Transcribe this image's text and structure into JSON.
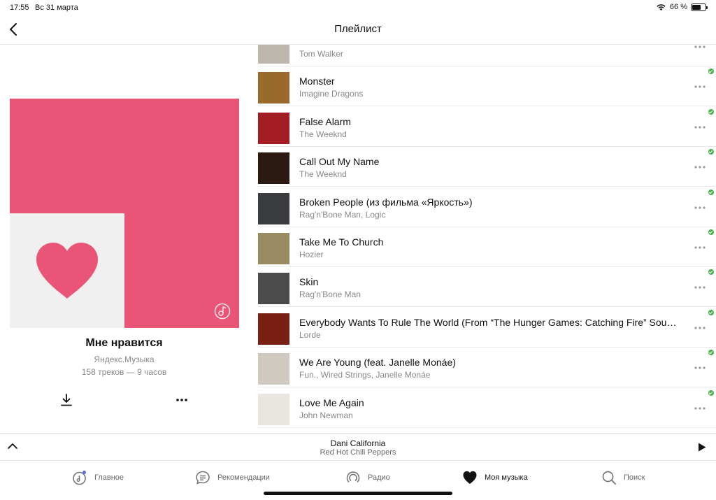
{
  "status_bar": {
    "time": "17:55",
    "date": "Вс 31 марта",
    "battery": "66 %",
    "battery_level": 0.66
  },
  "nav": {
    "title": "Плейлист"
  },
  "playlist": {
    "title": "Мне нравится",
    "owner": "Яндекс.Музыка",
    "meta": "158 треков — 9 часов",
    "cover_color": "#ea5577"
  },
  "tracks": [
    {
      "title": "",
      "artist": "Tom Walker",
      "art": "#bdb7ad",
      "downloaded": false
    },
    {
      "title": "Monster",
      "artist": "Imagine Dragons",
      "art": "#9a6a2c",
      "downloaded": true
    },
    {
      "title": "False Alarm",
      "artist": "The Weeknd",
      "art": "#a51d24",
      "downloaded": true
    },
    {
      "title": "Call Out My Name",
      "artist": "The Weeknd",
      "art": "#2c1a12",
      "downloaded": true
    },
    {
      "title": "Broken People (из фильма «Яркость»)",
      "artist": "Rag'n'Bone Man, Logic",
      "art": "#3a3b3e",
      "downloaded": true
    },
    {
      "title": "Take Me To Church",
      "artist": "Hozier",
      "art": "#9a8a62",
      "downloaded": true
    },
    {
      "title": "Skin",
      "artist": "Rag'n'Bone Man",
      "art": "#4b4b4b",
      "downloaded": true
    },
    {
      "title": "Everybody Wants To Rule The World (From “The Hunger Games: Catching Fire” Sou…",
      "artist": "Lorde",
      "art": "#7a1f14",
      "downloaded": true
    },
    {
      "title": "We Are Young (feat. Janelle Monáe)",
      "artist": "Fun., Wired Strings, Janelle Monáe",
      "art": "#cfc9bf",
      "downloaded": true
    },
    {
      "title": "Love Me Again",
      "artist": "John Newman",
      "art": "#e9e6e0",
      "downloaded": true
    }
  ],
  "player": {
    "title": "Dani California",
    "artist": "Red Hot Chili Peppers"
  },
  "tabs": [
    {
      "label": "Главное",
      "icon": "home-icon"
    },
    {
      "label": "Рекомендации",
      "icon": "chat-icon"
    },
    {
      "label": "Радио",
      "icon": "radio-icon"
    },
    {
      "label": "Моя музыка",
      "icon": "heart-icon",
      "active": true
    },
    {
      "label": "Поиск",
      "icon": "search-icon"
    }
  ],
  "colors": {
    "accent": "#ea5577",
    "downloaded_check": "#4caf50",
    "text_secondary": "#888888"
  }
}
